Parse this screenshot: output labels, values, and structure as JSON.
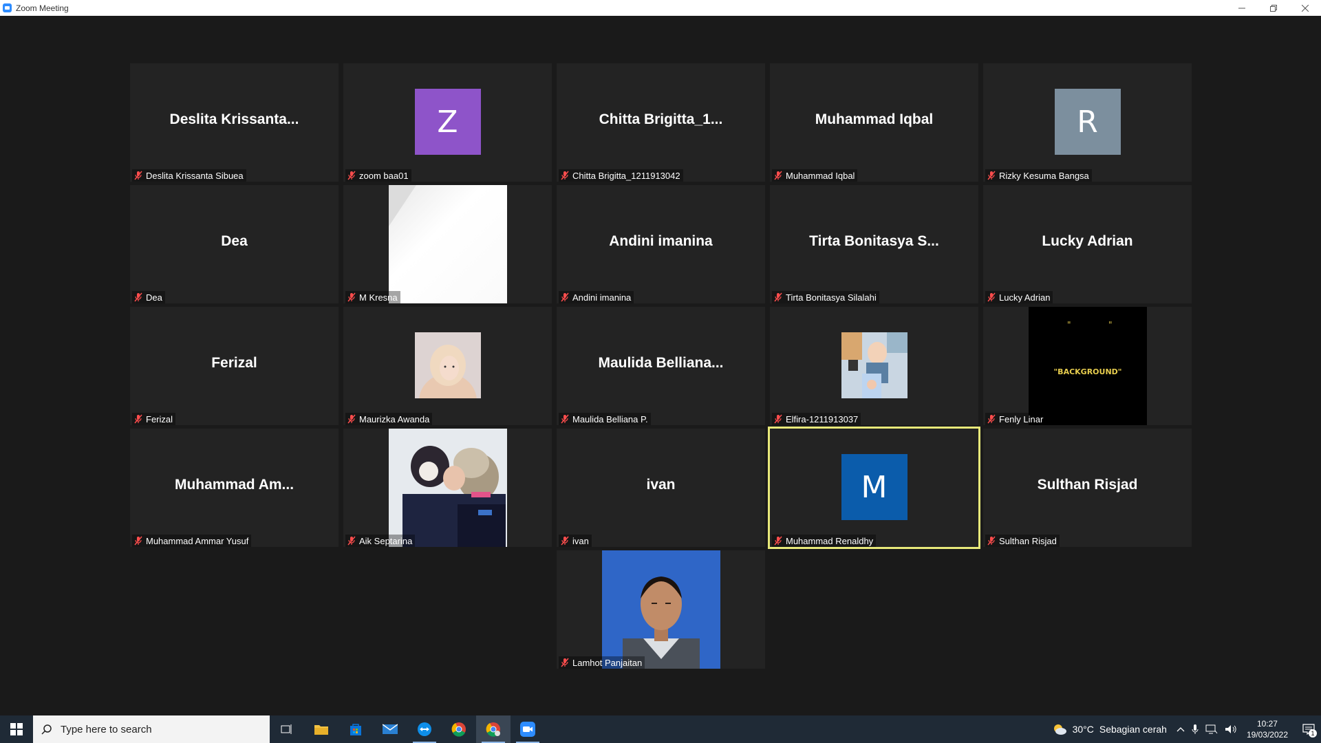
{
  "window": {
    "title": "Zoom Meeting"
  },
  "tiles": [
    {
      "big": "Deslita  Krissanta...",
      "label": "Deslita Krissanta Sibuea"
    },
    {
      "avatar": "Z",
      "avatar_color": "#8e54c9",
      "label": "zoom baa01"
    },
    {
      "big": "Chitta  Brigitta_1...",
      "label": "Chitta Brigitta_1211913042"
    },
    {
      "big": "Muhammad Iqbal",
      "label": "Muhammad Iqbal"
    },
    {
      "avatar": "R",
      "avatar_color": "#7c8f9e",
      "label": "Rizky Kesuma Bangsa"
    },
    {
      "big": "Dea",
      "label": "Dea"
    },
    {
      "photo": "white",
      "label": "M Kresna"
    },
    {
      "big": "Andini imanina",
      "label": "Andini imanina"
    },
    {
      "big": "Tirta Bonitasya S...",
      "label": "Tirta Bonitasya Silalahi"
    },
    {
      "big": "Lucky Adrian",
      "label": "Lucky Adrian"
    },
    {
      "big": "Ferizal",
      "label": "Ferizal"
    },
    {
      "photo": "hijab",
      "label": "Maurizka Awanda"
    },
    {
      "big": "Maulida  Belliana...",
      "label": "Maulida Belliana P."
    },
    {
      "photo": "collage",
      "label": "Elfira-1211913037"
    },
    {
      "photo": "background",
      "photo_text": "\"BACKGROUND\"",
      "label": "Fenly Linar"
    },
    {
      "big": "Muhammad  Am...",
      "label": "Muhammad Ammar Yusuf"
    },
    {
      "photo": "snow",
      "label": "Aik Septarina"
    },
    {
      "big": "ivan",
      "label": "ivan"
    },
    {
      "avatar": "M",
      "avatar_color": "#0b5cab",
      "label": "Muhammad Renaldhy",
      "active": true
    },
    {
      "big": "Sulthan Risjad",
      "label": "Sulthan Risjad"
    },
    {
      "photo": "portrait",
      "label": "Lamhot Panjaitan"
    }
  ],
  "taskbar": {
    "search_placeholder": "Type here to search",
    "weather_temp": "30°C",
    "weather_desc": "Sebagian cerah",
    "time": "10:27",
    "date": "19/03/2022",
    "notification_count": "1"
  }
}
